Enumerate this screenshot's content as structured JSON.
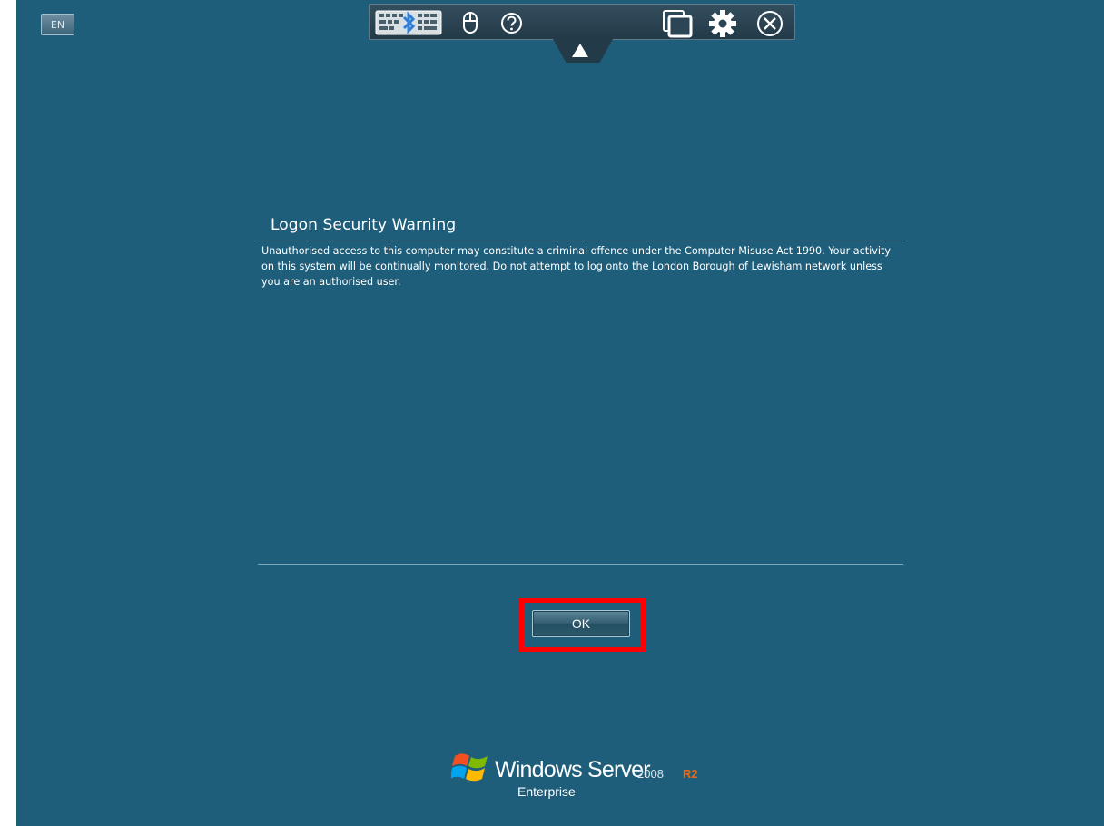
{
  "language": {
    "code": "EN"
  },
  "toolbar": {
    "icons": {
      "keyboard": "keyboard-bluetooth-icon",
      "mouse": "mouse-icon",
      "help": "help-icon",
      "window": "window-icon",
      "settings": "gear-icon",
      "close": "close-icon",
      "tab": "arrow-up-icon"
    }
  },
  "dialog": {
    "title": "Logon Security Warning",
    "message": "Unauthorised access to this computer may constitute a criminal offence under the Computer Misuse Act 1990. Your activity on this system will be continually monitored. Do not attempt to log onto the London Borough of Lewisham network unless you are an authorised user.",
    "ok_label": "OK"
  },
  "branding": {
    "product": "Windows Server",
    "version": "2008",
    "release": "R2",
    "edition": "Enterprise"
  },
  "colors": {
    "background": "#1f5e7a",
    "highlight": "#ff0000",
    "r2_accent": "#e66a19"
  }
}
